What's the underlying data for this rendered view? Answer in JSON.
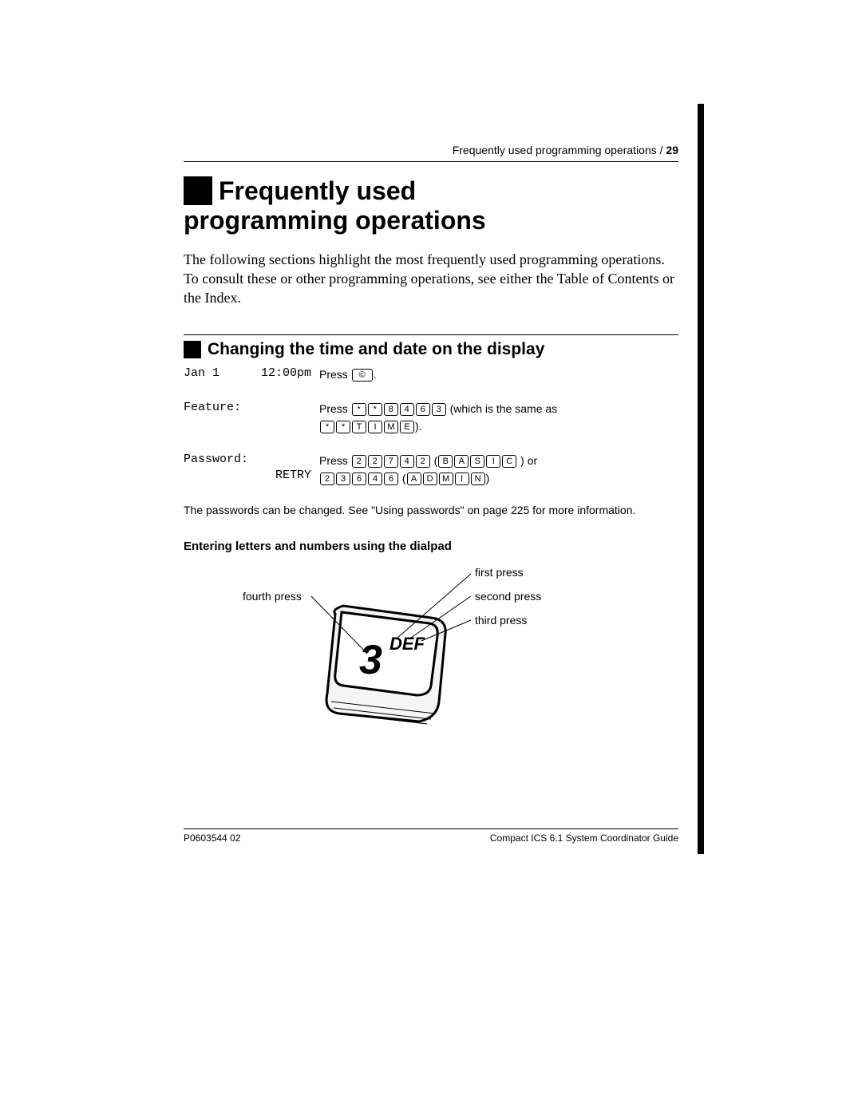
{
  "header": {
    "running_head": "Frequently used programming operations /",
    "page_number": "29"
  },
  "chapter": {
    "title_line1": "Frequently used",
    "title_line2": "programming operations"
  },
  "intro": "The following sections highlight the most frequently used programming operations. To consult these or other programming operations, see either the Table of Contents or the Index.",
  "section": {
    "title": "Changing the time and date on the display"
  },
  "steps": {
    "row1": {
      "lcd_left": "Jan 1",
      "lcd_right": "12:00pm",
      "instr_prefix": "Press",
      "key": "©",
      "suffix": "."
    },
    "row2": {
      "lcd": "Feature:",
      "instr_prefix": "Press",
      "seq1": [
        "*",
        "*",
        "8",
        "4",
        "6",
        "3"
      ],
      "mid": " (which is the same as ",
      "seq2": [
        "*",
        "*",
        "T",
        "I",
        "M",
        "E"
      ],
      "suffix": ")."
    },
    "row3": {
      "lcd": "Password:",
      "lcd_retry": "RETRY",
      "instr_prefix": "Press",
      "seq1": [
        "2",
        "2",
        "7",
        "4",
        "2"
      ],
      "open": " (",
      "seq2": [
        "B",
        "A",
        "S",
        "I",
        "C"
      ],
      "close_or": " ) or",
      "seq3": [
        "2",
        "3",
        "6",
        "4",
        "6"
      ],
      "open2": " (",
      "seq4": [
        "A",
        "D",
        "M",
        "I",
        "N"
      ],
      "close2": ")"
    }
  },
  "note": "The passwords can be changed. See \"Using passwords\" on page 225 for more information.",
  "subhead": "Entering letters and numbers using the dialpad",
  "diagram": {
    "labels": {
      "first": "first press",
      "second": "second press",
      "third": "third press",
      "fourth": "fourth press"
    },
    "key_digit": "3",
    "key_letters": "DEF"
  },
  "footer": {
    "left": "P0603544  02",
    "right": "Compact ICS 6.1 System Coordinator Guide"
  }
}
